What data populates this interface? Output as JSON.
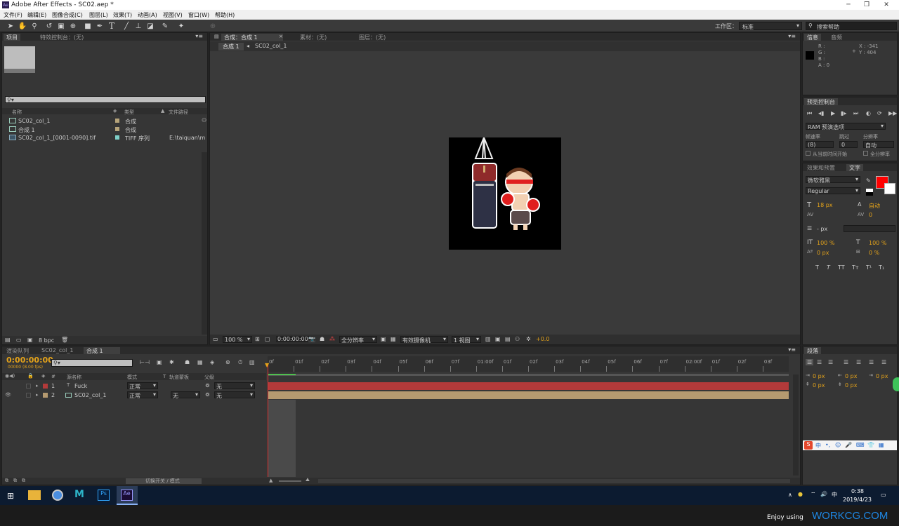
{
  "window": {
    "title": "Adobe After Effects - SC02.aep *",
    "app_icon_text": "Ae"
  },
  "menu": [
    "文件(F)",
    "编辑(E)",
    "图像合成(C)",
    "图层(L)",
    "效果(T)",
    "动画(A)",
    "视图(V)",
    "窗口(W)",
    "帮助(H)"
  ],
  "toolbar": {
    "workspace_label": "工作区：",
    "workspace_value": "标准",
    "search_placeholder": "搜索帮助"
  },
  "project_panel": {
    "tabs": [
      "项目",
      "特效控制台：(无)"
    ],
    "columns": [
      "名称",
      "类型",
      "文件路径"
    ],
    "items": [
      {
        "name": "SC02_col_1",
        "type": "合成",
        "path": ""
      },
      {
        "name": "合成 1",
        "type": "合成",
        "path": ""
      },
      {
        "name": "SC02_col_1_[0001-0090].tif",
        "type": "TIFF 序列",
        "path": "E:\\taiquan\\m"
      }
    ],
    "bpc": "8 bpc"
  },
  "comp_panel": {
    "tabs": [
      "合成：合成 1",
      "素材：(无)",
      "图层：(无)"
    ],
    "breadcrumb": [
      "合成 1",
      "SC02_col_1"
    ],
    "footer": {
      "zoom": "100 %",
      "timecode": "0:00:00:00",
      "resolution": "全分辨率",
      "camera": "有效摄像机",
      "views": "1 视图",
      "exposure": "+0.0"
    }
  },
  "info_panel": {
    "tabs": [
      "信息",
      "音频"
    ],
    "rgba": [
      "R :",
      "G :",
      "B :",
      "A : 0"
    ],
    "coords": [
      "X : -341",
      "Y : 404"
    ]
  },
  "preview_panel": {
    "tab": "预览控制台",
    "ram": "RAM 预演选项",
    "labels": [
      "帧速率",
      "跳过",
      "分辨率"
    ],
    "values": [
      "(8)",
      "0",
      "自动"
    ],
    "checkboxes": [
      "从当前时间开始",
      "全分辨率"
    ]
  },
  "text_panel": {
    "tabs": [
      "效果和预置",
      "文字"
    ],
    "font": "微软雅黑",
    "style": "Regular",
    "size": "18 px",
    "leading": "自动",
    "tracking": "0",
    "stroke": "- px",
    "vscale": "100 %",
    "hscale": "100 %",
    "baseline": "0 px",
    "tsume": "0 %",
    "fill_color": "#ff0000",
    "styles": [
      "T",
      "T",
      "TT",
      "Tт",
      "T¹",
      "T₁"
    ]
  },
  "timeline": {
    "tabs": [
      "渲染队列",
      "SC02_col_1",
      "合成 1"
    ],
    "timecode": "0:00:00:00",
    "fps": "00000 (8.00 fps)",
    "columns": [
      "#",
      "源名称",
      "模式",
      "T",
      "轨道蒙板",
      "父级"
    ],
    "layers": [
      {
        "num": "1",
        "name": "Fuck",
        "mode": "正常",
        "track": "",
        "parent": "无",
        "color": "#b33a3a"
      },
      {
        "num": "2",
        "name": "SC02_col_1",
        "mode": "正常",
        "track": "无",
        "parent": "无",
        "color": "#b59a70"
      }
    ],
    "ruler": [
      "0f",
      "01f",
      "02f",
      "03f",
      "04f",
      "05f",
      "06f",
      "07f",
      "01:00f",
      "01f",
      "02f",
      "03f",
      "04f",
      "05f",
      "06f",
      "07f",
      "02:00f",
      "01f",
      "02f",
      "03f"
    ],
    "footer_toggle": "切换开关 / 模式"
  },
  "paragraph_panel": {
    "tab": "段落",
    "values": [
      "0 px",
      "0 px",
      "0 px",
      "0 px",
      "0 px"
    ]
  },
  "taskbar": {
    "apps": [
      "file-explorer",
      "browser",
      "maya",
      "photoshop",
      "after-effects"
    ],
    "ps_label": "Ps",
    "ae_label": "Ae",
    "ime": "中",
    "time": "0:38",
    "date": "2019/4/23"
  },
  "watermark": {
    "text": "Enjoy using",
    "brand": "WORKCG.COM"
  }
}
